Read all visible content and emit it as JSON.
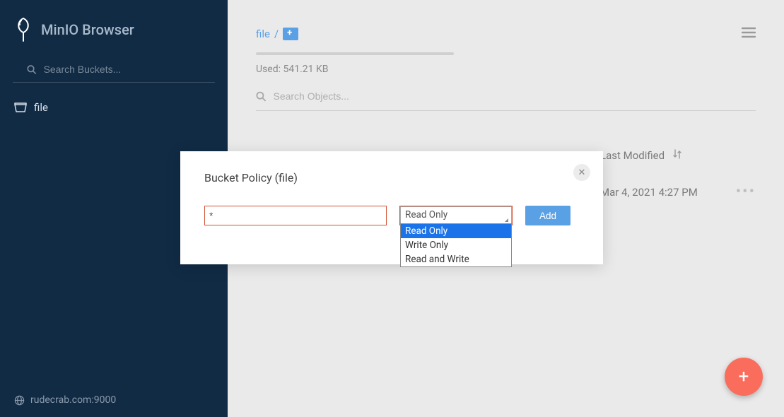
{
  "sidebar": {
    "title": "MinIO Browser",
    "search_placeholder": "Search Buckets...",
    "buckets": [
      {
        "name": "file"
      }
    ],
    "host": "rudecrab.com:9000"
  },
  "main": {
    "breadcrumb": {
      "bucket": "file"
    },
    "usage_text": "Used: 541.21 KB",
    "search_placeholder": "Search Objects...",
    "columns": {
      "modified": "Last Modified"
    },
    "rows": [
      {
        "modified": "Mar 4, 2021 4:27 PM"
      }
    ]
  },
  "modal": {
    "title": "Bucket Policy (file)",
    "prefix_value": "*",
    "select_value": "Read Only",
    "options": [
      "Read Only",
      "Write Only",
      "Read and Write"
    ],
    "add_label": "Add"
  },
  "fab": {
    "label": "+"
  }
}
